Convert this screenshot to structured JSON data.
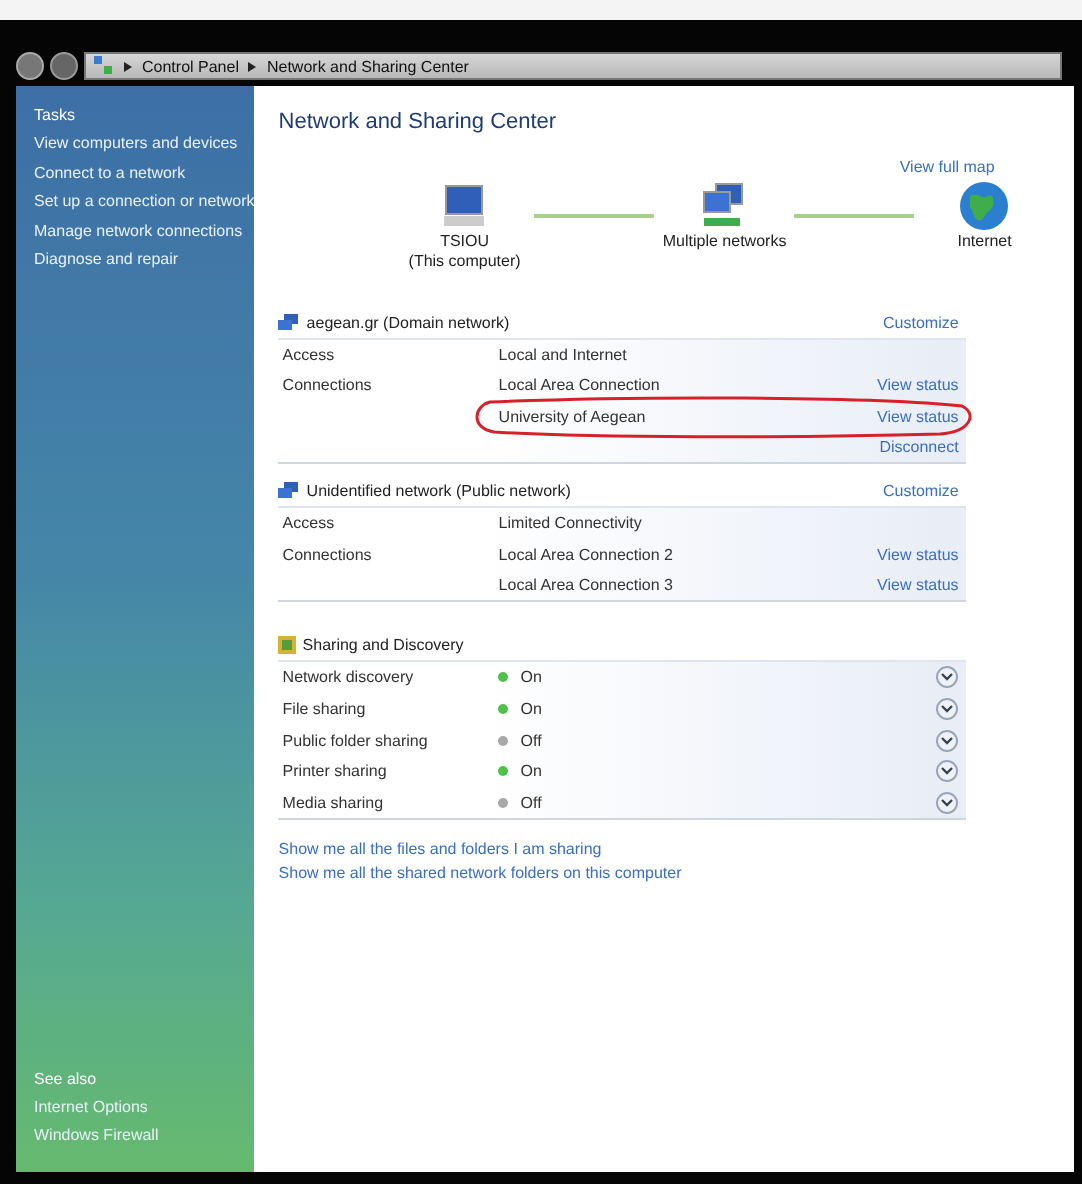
{
  "nav": {
    "crumbs": [
      "Control Panel",
      "Network and Sharing Center"
    ]
  },
  "sidebar": {
    "title": "Tasks",
    "items": [
      "View computers and devices",
      "Connect to a network",
      "Set up a connection or network",
      "Manage network connections",
      "Diagnose and repair"
    ],
    "see_also_title": "See also",
    "see_also": [
      "Internet Options",
      "Windows Firewall"
    ]
  },
  "main": {
    "title": "Network and Sharing Center",
    "map_link": "View full map",
    "map_nodes": [
      {
        "kind": "computer",
        "label": "TSIOU",
        "sublabel": "(This computer)"
      },
      {
        "kind": "networks",
        "label": "Multiple networks"
      },
      {
        "kind": "globe",
        "label": "Internet"
      }
    ],
    "networks": [
      {
        "name": "aegean.gr (Domain network)",
        "action": "Customize",
        "rows": [
          {
            "label": "Access",
            "value": "Local and Internet"
          },
          {
            "label": "Connections",
            "value": "Local Area Connection",
            "link": "View status"
          },
          {
            "value": "University of Aegean",
            "link": "View status",
            "circled": true
          },
          {
            "link": "Disconnect"
          }
        ]
      },
      {
        "name": "Unidentified network (Public network)",
        "action": "Customize",
        "rows": [
          {
            "label": "Access",
            "value": "Limited Connectivity"
          },
          {
            "label": "Connections",
            "value": "Local Area Connection 2",
            "link": "View status"
          },
          {
            "value": "Local Area Connection 3",
            "link": "View status"
          }
        ]
      }
    ],
    "sharing": {
      "title": "Sharing and Discovery",
      "items": [
        {
          "label": "Network discovery",
          "status": "On",
          "on": true
        },
        {
          "label": "File sharing",
          "status": "On",
          "on": true
        },
        {
          "label": "Public folder sharing",
          "status": "Off",
          "on": false
        },
        {
          "label": "Printer sharing",
          "status": "On",
          "on": true
        },
        {
          "label": "Media sharing",
          "status": "Off",
          "on": false
        }
      ]
    },
    "links": [
      "Show me all the files and folders I am sharing",
      "Show me all the shared network folders on this computer"
    ]
  }
}
